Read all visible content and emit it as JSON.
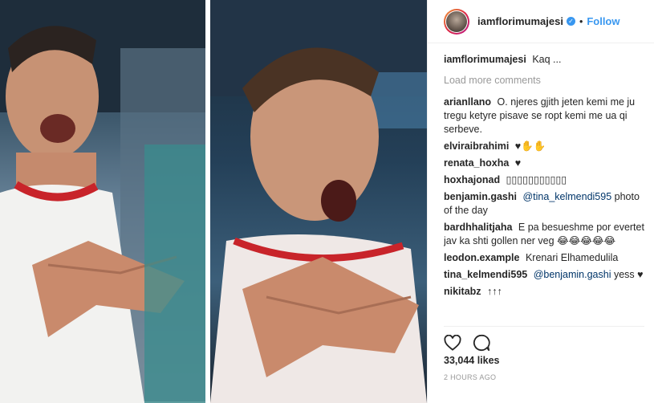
{
  "header": {
    "username": "iamflorimumajesi",
    "separator": "•",
    "follow_label": "Follow"
  },
  "caption": {
    "user": "iamflorimumajesi",
    "text": "Kaq ..."
  },
  "load_more_label": "Load more comments",
  "comments": [
    {
      "user": "arianllano",
      "text": "O. njeres gjith jeten kemi me ju tregu ketyre pisave se ropt kemi me ua qi serbeve."
    },
    {
      "user": "elviraibrahimi",
      "text": "♥✋✋"
    },
    {
      "user": "renata_hoxha",
      "text": "♥"
    },
    {
      "user": "hoxhajonad",
      "text": "▯▯▯▯▯▯▯▯▯▯▯"
    },
    {
      "user": "benjamin.gashi",
      "mention": "@tina_kelmendi595",
      "text": "photo of the day"
    },
    {
      "user": "bardhhalitjaha",
      "text": "E pa besueshme por evertet jav ka shti gollen ner veg 😂😂😂😂😂"
    },
    {
      "user": "leodon.example",
      "text": "Krenari Elhamedulila"
    },
    {
      "user": "tina_kelmendi595",
      "mention": "@benjamin.gashi",
      "text": "yess ♥"
    },
    {
      "user": "nikitabz",
      "text": "↑↑↑"
    }
  ],
  "actions": {
    "like_icon": "heart-icon",
    "comment_icon": "comment-icon"
  },
  "likes_text": "33,044 likes",
  "timestamp": "2 HOURS AGO",
  "colors": {
    "link_blue": "#3897f0",
    "mention_blue": "#003569",
    "muted": "#999999"
  }
}
